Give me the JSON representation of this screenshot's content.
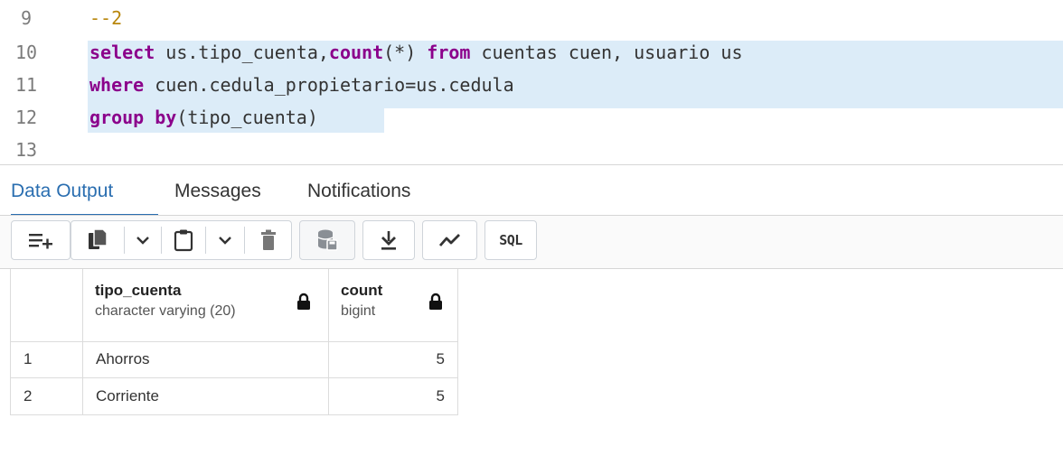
{
  "editor": {
    "lines": [
      {
        "num": "9",
        "segments": [
          {
            "text": "--2",
            "cls": "cm"
          }
        ]
      },
      {
        "num": "10",
        "segments": [
          {
            "text": "select",
            "cls": "kw"
          },
          {
            "text": " us.tipo_cuenta,",
            "cls": ""
          },
          {
            "text": "count",
            "cls": "kw"
          },
          {
            "text": "(*) ",
            "cls": ""
          },
          {
            "text": "from",
            "cls": "kw"
          },
          {
            "text": " cuentas cuen, usuario us",
            "cls": ""
          }
        ]
      },
      {
        "num": "11",
        "segments": [
          {
            "text": "where",
            "cls": "kw"
          },
          {
            "text": " cuen.cedula_propietario=us.cedula",
            "cls": ""
          }
        ]
      },
      {
        "num": "12",
        "segments": [
          {
            "text": "group by",
            "cls": "kw"
          },
          {
            "text": "(tipo_cuenta)",
            "cls": ""
          }
        ]
      },
      {
        "num": "13",
        "segments": []
      }
    ]
  },
  "tabs": [
    {
      "label": "Data Output",
      "active": true
    },
    {
      "label": "Messages",
      "active": false
    },
    {
      "label": "Notifications",
      "active": false
    }
  ],
  "toolbar": {
    "buttons": [
      {
        "name": "add-row-button",
        "icon": "add-row-icon"
      },
      {
        "name": "copy-button",
        "icon": "copy-icon"
      },
      {
        "name": "copy-options-dropdown",
        "icon": "chevron-down-icon"
      },
      {
        "name": "paste-button",
        "icon": "paste-icon"
      },
      {
        "name": "paste-options-dropdown",
        "icon": "chevron-down-icon"
      },
      {
        "name": "delete-button",
        "icon": "trash-icon"
      },
      {
        "name": "save-data-button",
        "icon": "database-save-icon"
      },
      {
        "name": "download-button",
        "icon": "download-icon"
      },
      {
        "name": "graph-visualiser-button",
        "icon": "line-chart-icon"
      },
      {
        "name": "sql-button",
        "icon": "sql-icon",
        "label": "SQL"
      }
    ]
  },
  "grid": {
    "columns": [
      {
        "name": "tipo_cuenta",
        "type": "character varying (20)"
      },
      {
        "name": "count",
        "type": "bigint"
      }
    ],
    "rows": [
      {
        "num": "1",
        "tipo_cuenta": "Ahorros",
        "count": "5"
      },
      {
        "num": "2",
        "tipo_cuenta": "Corriente",
        "count": "5"
      }
    ]
  }
}
